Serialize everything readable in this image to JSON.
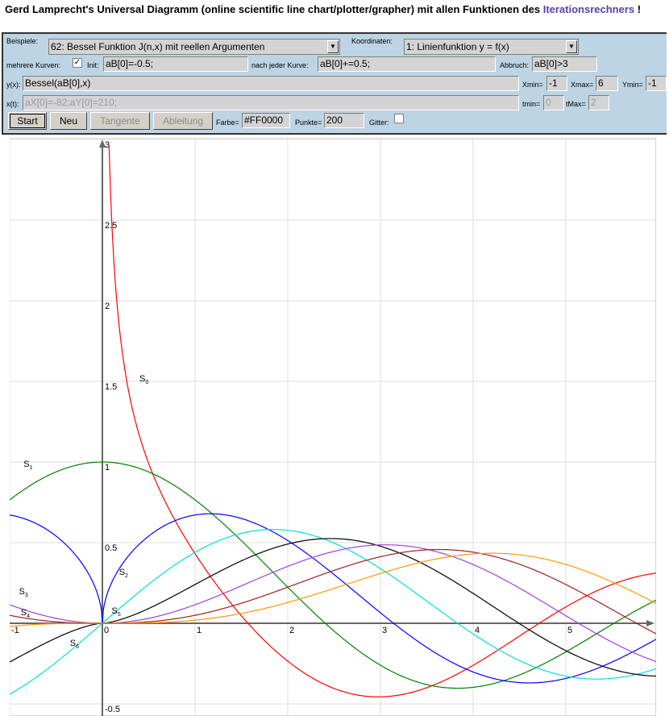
{
  "header": {
    "title_prefix": "Gerd Lamprecht's Universal Diagramm (online scientific line chart/plotter/grapher) mit allen Funktionen des",
    "link_text": "Iterationsrechners",
    "title_suffix": "!"
  },
  "controls": {
    "beispiele_label": "Beispiele:",
    "beispiele_value": "62: Bessel Funktion J(n,x) mit reellen Argumenten",
    "koordinaten_label": "Koordinaten:",
    "koordinaten_value": "1: Linienfunktion y = f(x)",
    "mehrere_label": "mehrere Kurven:",
    "mehrere_checked": "✓",
    "init_label": "Init:",
    "init_value": "aB[0]=-0.5;",
    "nach_label": "nach jeder Kurve:",
    "nach_value": "aB[0]+=0.5;",
    "abbruch_label": "Abbruch:",
    "abbruch_value": "aB[0]>3",
    "yx_label": "y(x):",
    "yx_value": "Bessel(aB[0],x)",
    "xmin_label": "Xmin=",
    "xmin_value": "-1",
    "xmax_label": "Xmax=",
    "xmax_value": "6",
    "ymin_label": "Ymin=",
    "ymin_value": "-1",
    "xt_label": "x(t):",
    "xt_value": "aX[0]=-82;aY[0]=210;",
    "tmin_label": "tmin=",
    "tmin_value": "0",
    "tmax_label": "tMax=",
    "tmax_value": "2",
    "start_label": "Start",
    "neu_label": "Neu",
    "tangente_label": "Tangente",
    "ableitung_label": "Ableitung",
    "farbe_label": "Farbe=",
    "farbe_value": "#FF0000",
    "punkte_label": "Punkte=",
    "punkte_value": "200",
    "gitter_label": "Gitter:"
  },
  "chart_data": {
    "type": "line",
    "xlim": [
      -1,
      6
    ],
    "ylim": [
      -0.5,
      3
    ],
    "grid": true,
    "x_ticks": [
      "-1",
      "0",
      "1",
      "2",
      "3",
      "4",
      "5"
    ],
    "y_ticks": [
      "-0.5",
      "0.5",
      "1",
      "1.5",
      "2",
      "2.5",
      "3"
    ],
    "function": "Bessel(aB[0],x)",
    "orders": [
      -0.5,
      0,
      0.5,
      1,
      1.5,
      2,
      2.5,
      3
    ],
    "series": [
      {
        "order": -0.5,
        "color": "#ff0000"
      },
      {
        "order": 0,
        "color": "#008000"
      },
      {
        "order": 0.5,
        "color": "#0000ff"
      },
      {
        "order": 1,
        "color": "#00e0e0"
      },
      {
        "order": 1.5,
        "color": "#000000"
      },
      {
        "order": 2,
        "color": "#a040e0"
      },
      {
        "order": 2.5,
        "color": "#a02020"
      },
      {
        "order": 3,
        "color": "#ff9900"
      }
    ],
    "labels": [
      {
        "text": "S",
        "sub": "0",
        "x": 0.4,
        "y": 1.5
      },
      {
        "text": "S",
        "sub": "1",
        "x": -0.85,
        "y": 0.97
      },
      {
        "text": "S",
        "sub": "2",
        "x": 0.18,
        "y": 0.3
      },
      {
        "text": "S",
        "sub": "3",
        "x": -0.9,
        "y": 0.18
      },
      {
        "text": "S",
        "sub": "4",
        "x": -0.88,
        "y": 0.05
      },
      {
        "text": "S",
        "sub": "5",
        "x": 0.1,
        "y": 0.06
      },
      {
        "text": "S",
        "sub": "6",
        "x": -0.35,
        "y": -0.14
      }
    ]
  }
}
